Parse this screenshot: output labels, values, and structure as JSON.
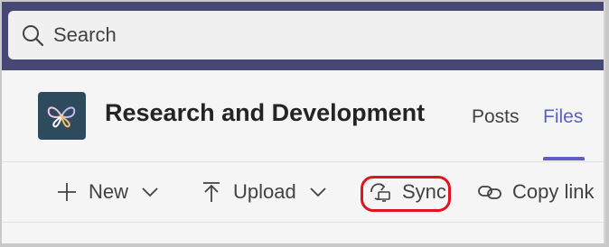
{
  "search": {
    "placeholder": "Search"
  },
  "team": {
    "name": "Research and Development",
    "logo": "team-logo-icon"
  },
  "tabs": [
    {
      "label": "Posts",
      "active": false
    },
    {
      "label": "Files",
      "active": true
    }
  ],
  "toolbar": {
    "new_label": "New",
    "upload_label": "Upload",
    "sync_label": "Sync",
    "copy_link_label": "Copy link"
  },
  "colors": {
    "topbar": "#464775",
    "accent": "#5b5fc7",
    "highlight": "#e0141e"
  }
}
